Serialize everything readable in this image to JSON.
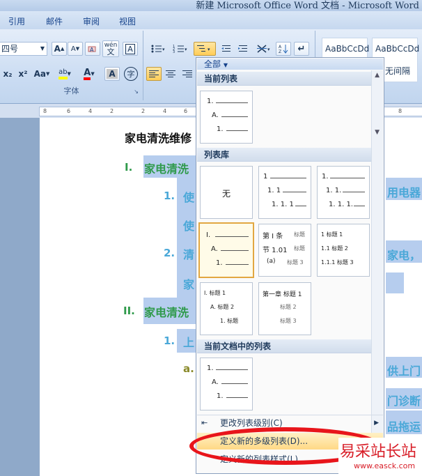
{
  "window": {
    "title": "新建 Microsoft Office Word 文档 - Microsoft Word"
  },
  "tabs": [
    "引用",
    "邮件",
    "审阅",
    "视图"
  ],
  "font_group": {
    "size_value": "四号",
    "label": "字体",
    "grow_label": "A",
    "shrink_label": "A",
    "subscript_label": "x₂",
    "superscript_label": "x²",
    "case_label": "Aa",
    "highlight_label": "ab",
    "color_label": "A",
    "phonetic_label": "wén",
    "border_label": "A",
    "enclose_label": "字",
    "highlight_color": "#ffff00",
    "font_color": "#ff0000"
  },
  "styles": [
    {
      "preview": "AaBbCcDd",
      "name": ""
    },
    {
      "preview": "AaBbCcDd",
      "name": "无间隔"
    }
  ],
  "ruler": {
    "ticks": [
      "8",
      "6",
      "4",
      "2",
      "2",
      "4",
      "6",
      "8"
    ]
  },
  "document": {
    "heading": "家电清洗维修",
    "items": [
      {
        "marker": "I.",
        "text": "家电清洗",
        "color": "#2f9a4b"
      },
      {
        "marker": "1.",
        "text": "使",
        "color": "#4aa8d8"
      },
      {
        "marker": "",
        "text": "使",
        "color": "#4aa8d8"
      },
      {
        "marker": "2.",
        "text": "清",
        "color": "#4aa8d8"
      },
      {
        "marker": "",
        "text": "家",
        "color": "#4aa8d8"
      },
      {
        "marker": "II.",
        "text": "家电清洗",
        "color": "#2f9a4b"
      },
      {
        "marker": "1.",
        "text": "上",
        "color": "#4aa8d8"
      },
      {
        "marker": "a.",
        "text": "",
        "color": "#8a8a2a"
      }
    ],
    "right_fragments": [
      "用电器",
      "家电，",
      "供上门",
      "门诊断",
      "品拖运"
    ]
  },
  "menu": {
    "filter_label": "全部",
    "sections": {
      "current": "当前列表",
      "library": "列表库",
      "in_document": "当前文档中的列表"
    },
    "none_label": "无",
    "tile_texts": {
      "t1": [
        "1.",
        "A.",
        "1."
      ],
      "t2": [
        "1",
        "1. 1",
        "1. 1. 1"
      ],
      "t3": [
        "1.",
        "1. 1.",
        "1. 1. 1."
      ],
      "t4": [
        "I.",
        "A.",
        "1."
      ],
      "t5": [
        "第 I 条",
        "节 1.01",
        "(a)",
        "标题",
        "标题",
        "标题 3"
      ],
      "t6": [
        "1 标题 1",
        "1.1 标题 2",
        "1.1.1 标题 3"
      ],
      "t7": [
        "I. 标题 1",
        "A. 标题 2",
        "1. 标题"
      ],
      "t8": [
        "第一章 标题 1",
        "标题 2",
        "标题 3"
      ],
      "t9": [
        "1.",
        "A.",
        "1."
      ]
    },
    "commands": {
      "change_level": "更改列表级别(C)",
      "define_multilevel": "定义新的多级列表(D)...",
      "define_style": "定义新的列表样式(L)..."
    }
  },
  "watermark": {
    "line1": "易采站长站",
    "line2": "www.easck.com"
  },
  "colors": {
    "accent_oval": "#e8151b",
    "watermark_red": "#d81e28"
  }
}
